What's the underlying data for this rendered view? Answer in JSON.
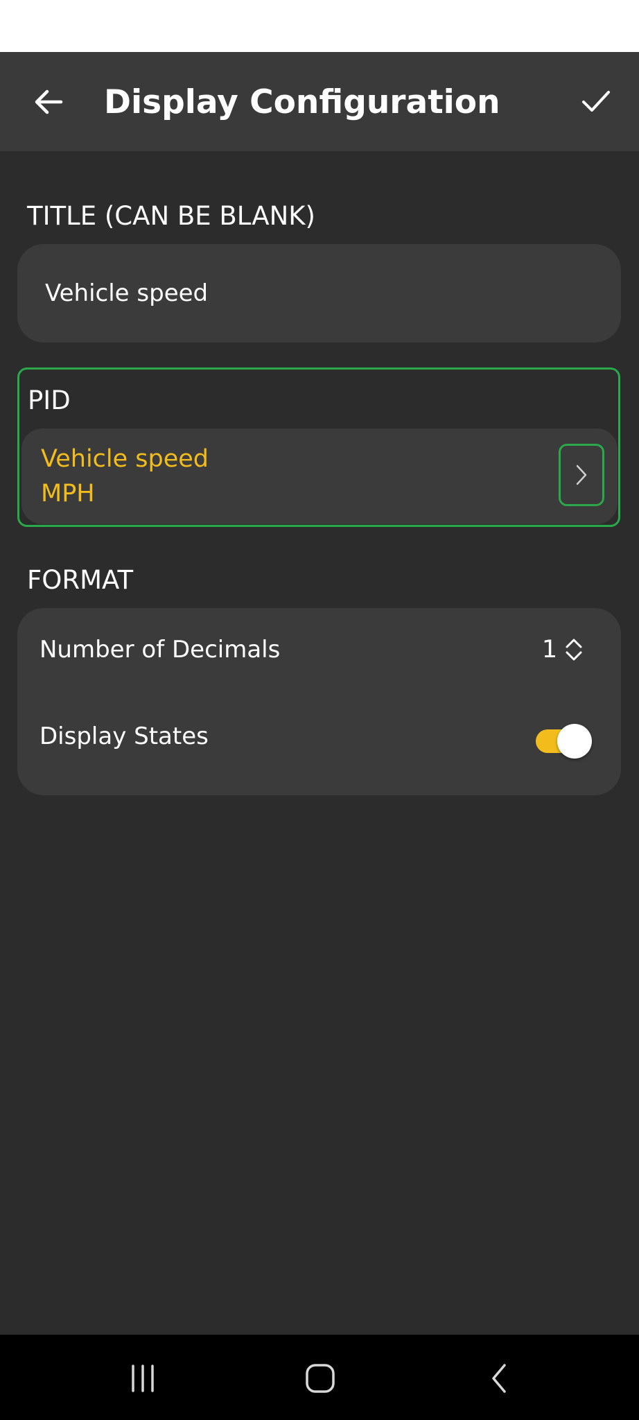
{
  "app_bar": {
    "title": "Display Configuration",
    "back_icon": "arrow-left-icon",
    "confirm_icon": "check-icon"
  },
  "title_section": {
    "label": "TITLE (CAN BE BLANK)",
    "value": "Vehicle speed",
    "placeholder": ""
  },
  "pid_section": {
    "label": "PID",
    "name": "Vehicle speed",
    "unit": "MPH",
    "chevron_icon": "chevron-right-icon"
  },
  "format_section": {
    "label": "FORMAT",
    "decimals_label": "Number of Decimals",
    "decimals_value": "1",
    "stepper_icon": "up-down-chevron-icon",
    "display_states_label": "Display States",
    "display_states_on": true
  },
  "nav": {
    "recents_icon": "recents-icon",
    "home_icon": "home-icon",
    "back_icon": "nav-back-icon"
  },
  "colors": {
    "background": "#2c2c2c",
    "app_bar": "#3a3a3a",
    "card": "#3b3b3b",
    "accent_yellow": "#f2bd1c",
    "highlight_green": "#2aa84a",
    "text": "#ffffff"
  }
}
